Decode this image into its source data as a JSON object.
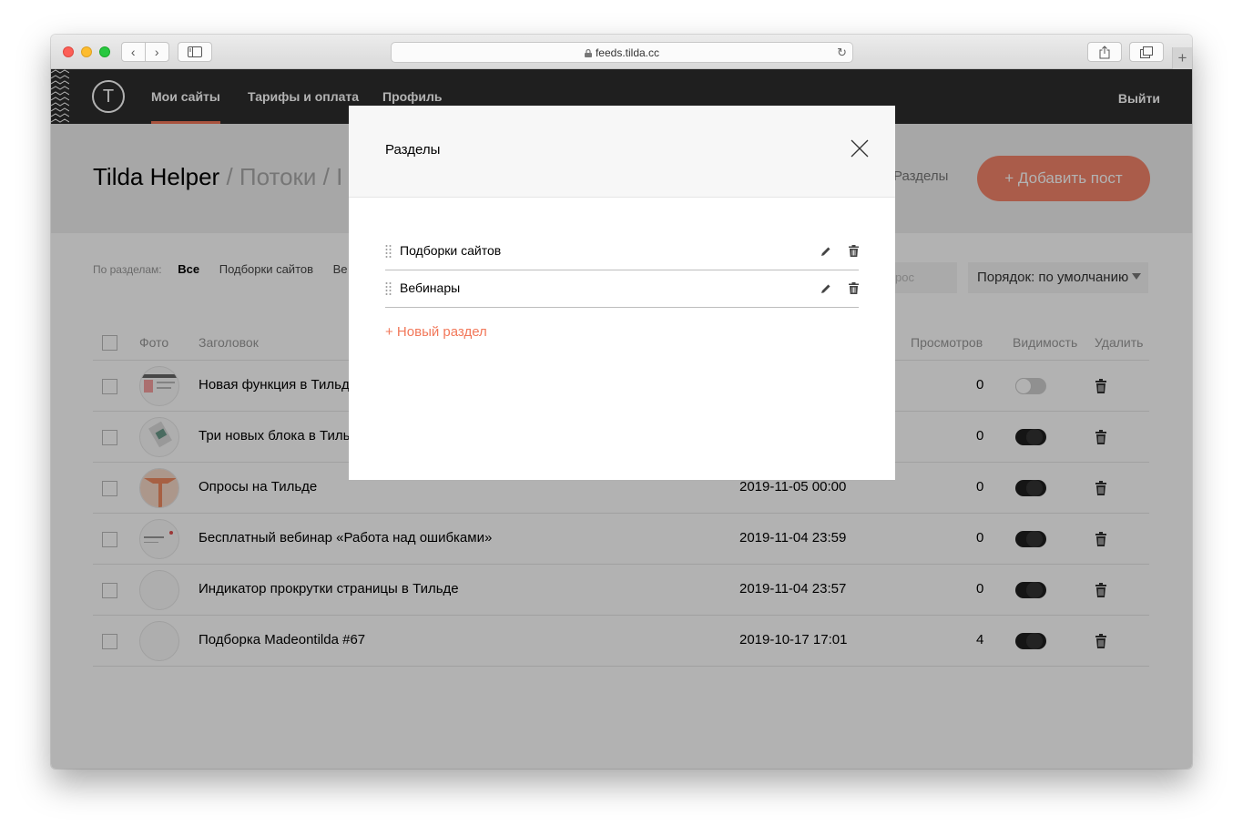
{
  "browser": {
    "url": "feeds.tilda.cc",
    "plus_glyph": "+",
    "back_glyph": "‹",
    "forward_glyph": "›",
    "reload_glyph": "↻"
  },
  "nav": {
    "logo_glyph": "T",
    "items": [
      {
        "label": "Мои сайты",
        "active": true
      },
      {
        "label": "Тарифы и оплата",
        "active": false
      },
      {
        "label": "Профиль",
        "active": false
      }
    ],
    "logout": "Выйти"
  },
  "header": {
    "title_main": "Tilda Helper",
    "title_sep1": " / ",
    "title_crumb": "Потоки",
    "title_sep2": " / ",
    "title_tail": "I",
    "sections_link": "Разделы",
    "add_post": "+  Добавить пост"
  },
  "filters": {
    "label": "По разделам:",
    "all": "Все",
    "section1": "Подборки сайтов",
    "section2": "Ве"
  },
  "search": {
    "placeholder": "рос"
  },
  "order": {
    "value": "Порядок: по умолчанию"
  },
  "table": {
    "columns": {
      "photo": "Фото",
      "title": "Заголовок",
      "views": "Просмотров",
      "visibility": "Видимость",
      "delete": "Удалить"
    },
    "rows": [
      {
        "title": "Новая функция в Тильде",
        "date": "",
        "views": "0",
        "visible": false
      },
      {
        "title": "Три новых блока в Тильд",
        "date": "",
        "views": "0",
        "visible": true
      },
      {
        "title": "Опросы на Тильде",
        "date": "2019-11-05 00:00",
        "views": "0",
        "visible": true
      },
      {
        "title": "Бесплатный вебинар «Работа над ошибками»",
        "date": "2019-11-04 23:59",
        "views": "0",
        "visible": true
      },
      {
        "title": "Индикатор прокрутки страницы в Тильде",
        "date": "2019-11-04 23:57",
        "views": "0",
        "visible": true
      },
      {
        "title": "Подборка Madeontilda #67",
        "date": "2019-10-17 17:01",
        "views": "4",
        "visible": true
      }
    ]
  },
  "modal": {
    "title": "Разделы",
    "sections": [
      {
        "label": "Подборки сайтов"
      },
      {
        "label": "Вебинары"
      }
    ],
    "new_section": "+ Новый раздел"
  },
  "colors": {
    "accent": "#f2785a",
    "topbar": "#2d2d2d"
  }
}
